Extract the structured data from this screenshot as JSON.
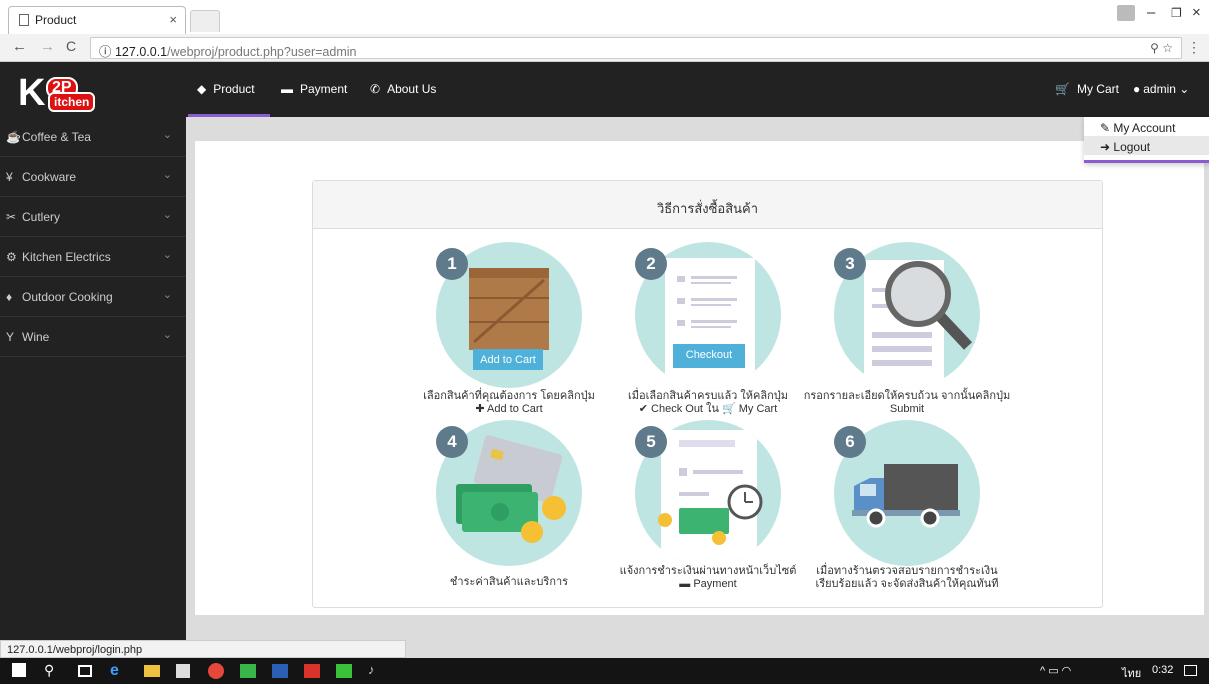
{
  "browser": {
    "tab_title": "Product",
    "tab_close": "×",
    "url_host": "127.0.0.1",
    "url_path": "/webproj/product.php?user=admin",
    "window_controls": [
      "–",
      "❐",
      "×"
    ]
  },
  "navbar": {
    "logo_k": "K",
    "logo_2p": "2P",
    "logo_kitchen": "itchen",
    "items": [
      {
        "label": "Product",
        "icon": "tags-icon"
      },
      {
        "label": "Payment",
        "icon": "credit-card-icon"
      },
      {
        "label": "About Us",
        "icon": "phone-icon"
      }
    ],
    "cart_label": "My Cart",
    "user_label": "admin"
  },
  "user_menu": {
    "items": [
      {
        "label": "My Account",
        "icon": "edit-icon"
      },
      {
        "label": "Logout",
        "icon": "logout-icon"
      }
    ]
  },
  "sidebar": {
    "items": [
      {
        "label": "Coffee & Tea",
        "icon": "cup-icon"
      },
      {
        "label": "Cookware",
        "icon": "cutlery-icon"
      },
      {
        "label": "Cutlery",
        "icon": "scissors-icon"
      },
      {
        "label": "Kitchen Electrics",
        "icon": "gear-icon"
      },
      {
        "label": "Outdoor Cooking",
        "icon": "fire-icon"
      },
      {
        "label": "Wine",
        "icon": "glass-icon"
      }
    ]
  },
  "panel": {
    "title": "วิธีการสั่งซื้อสินค้า"
  },
  "steps": [
    {
      "num": "1",
      "button": "Add to Cart",
      "line1": "เลือกสินค้าที่คุณต้องการ โดยคลิกปุ่ม",
      "line2": "✚ Add to Cart"
    },
    {
      "num": "2",
      "button": "Checkout",
      "line1": "เมื่อเลือกสินค้าครบแล้ว ให้คลิกปุ่ม",
      "line2": "✔ Check Out ใน 🛒 My Cart"
    },
    {
      "num": "3",
      "line1": "กรอกรายละเอียดให้ครบถ้วน จากนั้นคลิกปุ่ม",
      "line2": "Submit"
    },
    {
      "num": "4",
      "line1": "ชำระค่าสินค้าและบริการ",
      "line2": ""
    },
    {
      "num": "5",
      "line1": "แจ้งการชำระเงินผ่านทางหน้าเว็บไซต์",
      "line2": "▬ Payment"
    },
    {
      "num": "6",
      "line1": "เมื่อทางร้านตรวจสอบรายการชำระเงิน",
      "line2": "เรียบร้อยแล้ว จะจัดส่งสินค้าให้คุณทันที"
    }
  ],
  "statusbar": {
    "text": "127.0.0.1/webproj/login.php"
  },
  "taskbar": {
    "lang": "ไทย",
    "time": "0:32"
  },
  "colors": {
    "navbar": "#222222",
    "accent": "#8a5cd0",
    "circle": "#bfe5e3",
    "button": "#4fb0d9"
  }
}
